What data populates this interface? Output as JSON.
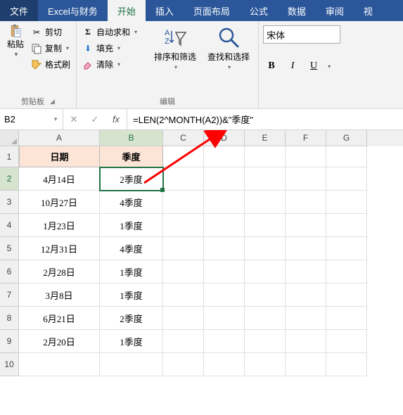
{
  "tabs": {
    "file": "文件",
    "custom": "Excel与财务",
    "home": "开始",
    "insert": "插入",
    "pagelayout": "页面布局",
    "formulas": "公式",
    "data": "数据",
    "review": "审阅",
    "view": "视"
  },
  "clipboard": {
    "paste": "粘贴",
    "cut": "剪切",
    "copy": "复制",
    "format_painter": "格式刷",
    "group_label": "剪贴板"
  },
  "edit": {
    "autosum": "自动求和",
    "fill": "填充",
    "clear": "清除",
    "group_label": "编辑"
  },
  "sortfilter": {
    "label": "排序和筛选"
  },
  "findselect": {
    "label": "查找和选择"
  },
  "font": {
    "name": "宋体",
    "bold": "B",
    "italic": "I",
    "underline": "U"
  },
  "namebox": {
    "value": "B2"
  },
  "formula_bar": {
    "value": "=LEN(2^MONTH(A2))&\"季度\""
  },
  "columns": [
    "A",
    "B",
    "C",
    "D",
    "E",
    "F",
    "G"
  ],
  "headers": {
    "A": "日期",
    "B": "季度"
  },
  "rows": [
    {
      "A": "4月14日",
      "B": "2季度"
    },
    {
      "A": "10月27日",
      "B": "4季度"
    },
    {
      "A": "1月23日",
      "B": "1季度"
    },
    {
      "A": "12月31日",
      "B": "4季度"
    },
    {
      "A": "2月28日",
      "B": "1季度"
    },
    {
      "A": "3月8日",
      "B": "1季度"
    },
    {
      "A": "6月21日",
      "B": "2季度"
    },
    {
      "A": "2月20日",
      "B": "1季度"
    }
  ],
  "chart_data": {
    "type": "table",
    "title": "",
    "columns": [
      "日期",
      "季度"
    ],
    "data": [
      [
        "4月14日",
        "2季度"
      ],
      [
        "10月27日",
        "4季度"
      ],
      [
        "1月23日",
        "1季度"
      ],
      [
        "12月31日",
        "4季度"
      ],
      [
        "2月28日",
        "1季度"
      ],
      [
        "3月8日",
        "1季度"
      ],
      [
        "6月21日",
        "2季度"
      ],
      [
        "2月20日",
        "1季度"
      ]
    ]
  }
}
